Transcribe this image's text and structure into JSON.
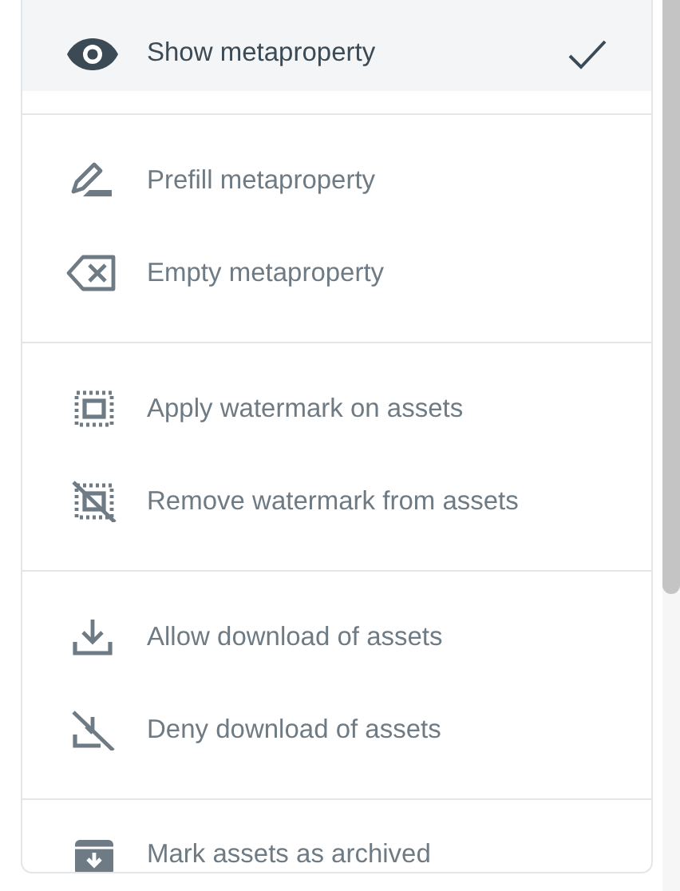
{
  "menu": {
    "groups": [
      {
        "items": [
          {
            "kind": "show",
            "label": "Show metaproperty",
            "checked": true
          }
        ]
      },
      {
        "items": [
          {
            "kind": "prefill",
            "label": "Prefill metaproperty",
            "checked": false
          },
          {
            "kind": "empty",
            "label": "Empty metaproperty",
            "checked": false
          }
        ]
      },
      {
        "items": [
          {
            "kind": "watermark",
            "label": "Apply watermark on assets",
            "checked": false
          },
          {
            "kind": "unwatermark",
            "label": "Remove watermark from assets",
            "checked": false
          }
        ]
      },
      {
        "items": [
          {
            "kind": "download",
            "label": "Allow download of assets",
            "checked": false
          },
          {
            "kind": "nodownload",
            "label": "Deny download of assets",
            "checked": false
          }
        ]
      },
      {
        "items": [
          {
            "kind": "archive",
            "label": "Mark assets as archived",
            "checked": false
          }
        ]
      }
    ]
  }
}
